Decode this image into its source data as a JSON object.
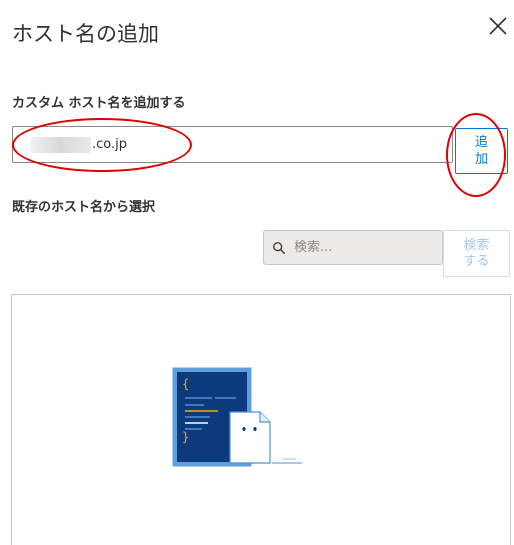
{
  "dialog": {
    "title": "ホスト名の追加",
    "close_icon": "close-icon"
  },
  "custom_hostname": {
    "label": "カスタム ホスト名を追加する",
    "value_visible": ".co.jp",
    "add_button_label": "追加"
  },
  "existing_hostname": {
    "label": "既存のホスト名から選択",
    "search_placeholder": "検索...",
    "search_icon": "search-icon",
    "search_button_label": "検索する"
  },
  "empty_state": {
    "illustration": "empty-document-illustration"
  },
  "colors": {
    "accent": "#0078d4",
    "annotation": "#e00000",
    "illustration_dark": "#0d3a7a"
  }
}
